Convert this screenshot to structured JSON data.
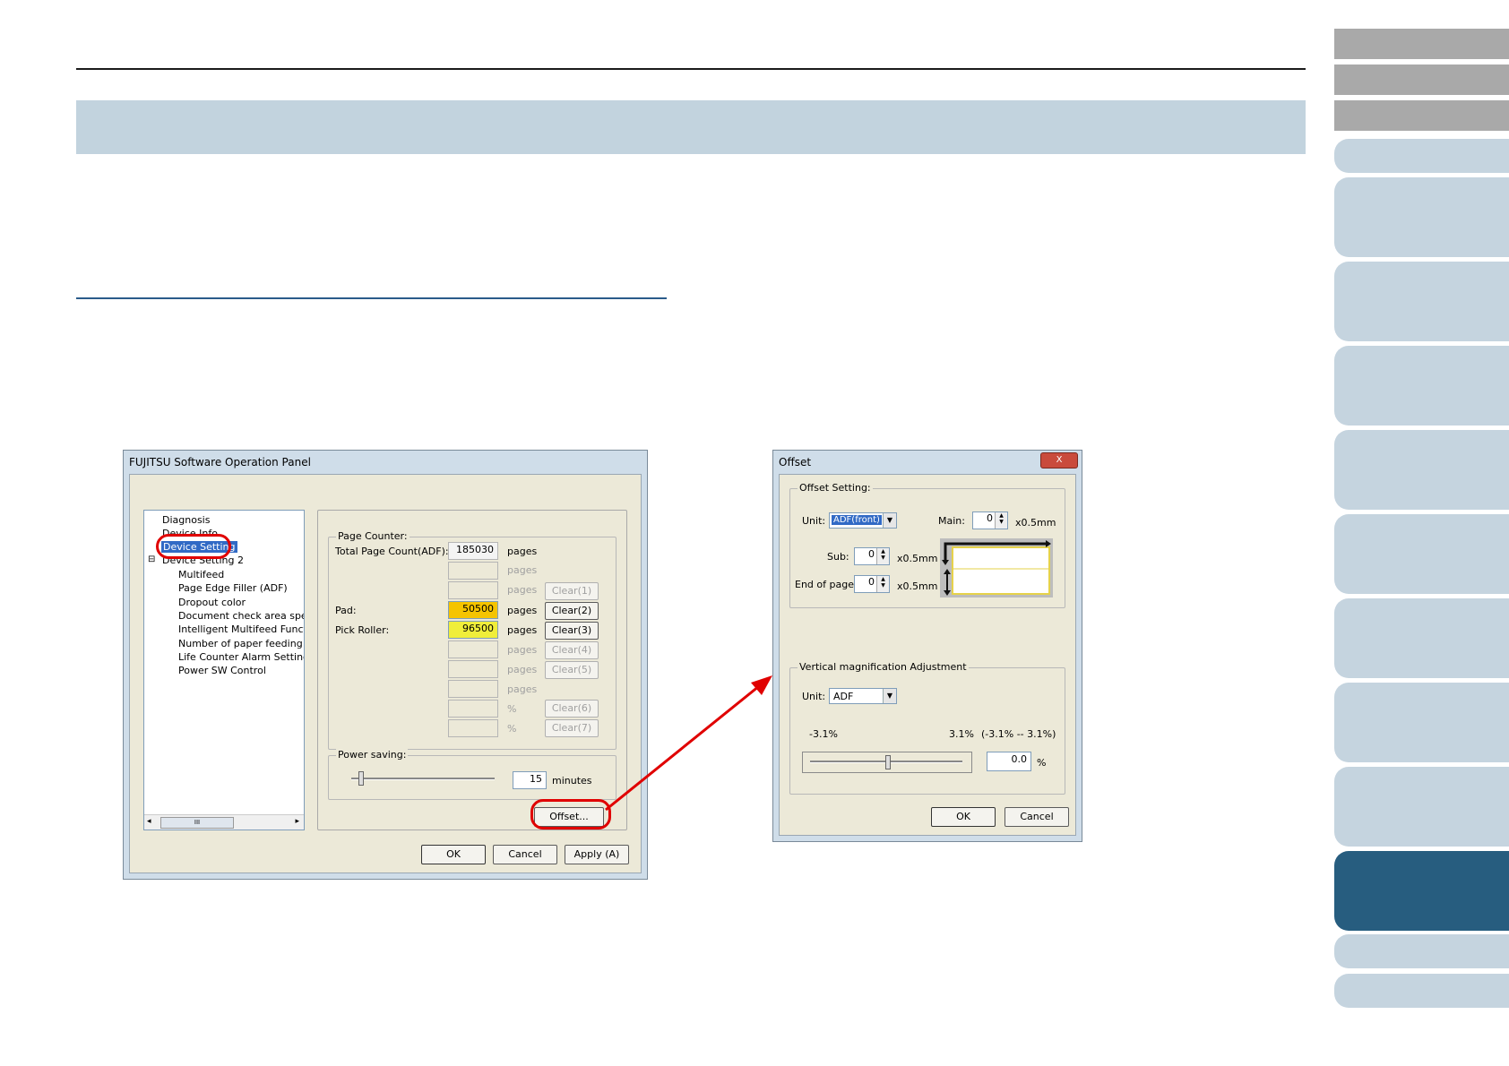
{
  "panel": {
    "title": "FUJITSU Software Operation Panel",
    "tree": [
      {
        "label": "Diagnosis"
      },
      {
        "label": "Device Info"
      },
      {
        "label": "Device Setting"
      },
      {
        "label": "Device Setting 2"
      },
      {
        "label": "Multifeed"
      },
      {
        "label": "Page Edge Filler (ADF)"
      },
      {
        "label": "Dropout color"
      },
      {
        "label": "Document check area specific"
      },
      {
        "label": "Intelligent Multifeed Function"
      },
      {
        "label": "Number of paper feeding retrie"
      },
      {
        "label": "Life Counter Alarm Setting"
      },
      {
        "label": "Power SW Control"
      }
    ],
    "tree_expander": "⊟",
    "tree_scroll_glyph": "III",
    "page_counter": {
      "label": "Page Counter:",
      "total_label": "Total Page Count(ADF):",
      "total_value": "185030",
      "pages": "pages",
      "pad_label": "Pad:",
      "pad_value": "50500",
      "pick_label": "Pick Roller:",
      "pick_value": "96500",
      "percent": "%",
      "clear1": "Clear(1)",
      "clear2": "Clear(2)",
      "clear3": "Clear(3)",
      "clear4": "Clear(4)",
      "clear5": "Clear(5)",
      "clear6": "Clear(6)",
      "clear7": "Clear(7)"
    },
    "power_saving": {
      "label": "Power saving:",
      "value": "15",
      "unit": "minutes",
      "level": 0.05
    },
    "offset_button": "Offset...",
    "ok": "OK",
    "cancel": "Cancel",
    "apply": "Apply (A)"
  },
  "offset_dialog": {
    "title": "Offset",
    "close": "X",
    "offset_setting": {
      "label": "Offset Setting:",
      "unit_label": "Unit:",
      "unit_value": "ADF(front)",
      "main_label": "Main:",
      "main_value": "0",
      "sub_label": "Sub:",
      "sub_value": "0",
      "end_label": "End of page:",
      "end_value": "0",
      "unit_suffix": "x0.5mm"
    },
    "vertical": {
      "label": "Vertical magnification Adjustment",
      "unit_label": "Unit:",
      "unit_value": "ADF",
      "min": "-3.1%",
      "max": "3.1%",
      "range": "(-3.1% -- 3.1%)",
      "value": "0.0",
      "percent": "%",
      "level": 0.5
    },
    "ok": "OK",
    "cancel": "Cancel"
  },
  "colors": {
    "title_band": "#c2d3de",
    "nav_light": "#c5d4df",
    "nav_dark": "#275d7f",
    "nav_gray": "#a9a9a9",
    "highlight_ring": "#e00000",
    "pad_field": "#f5c400",
    "pick_field": "#f0ee3a"
  }
}
